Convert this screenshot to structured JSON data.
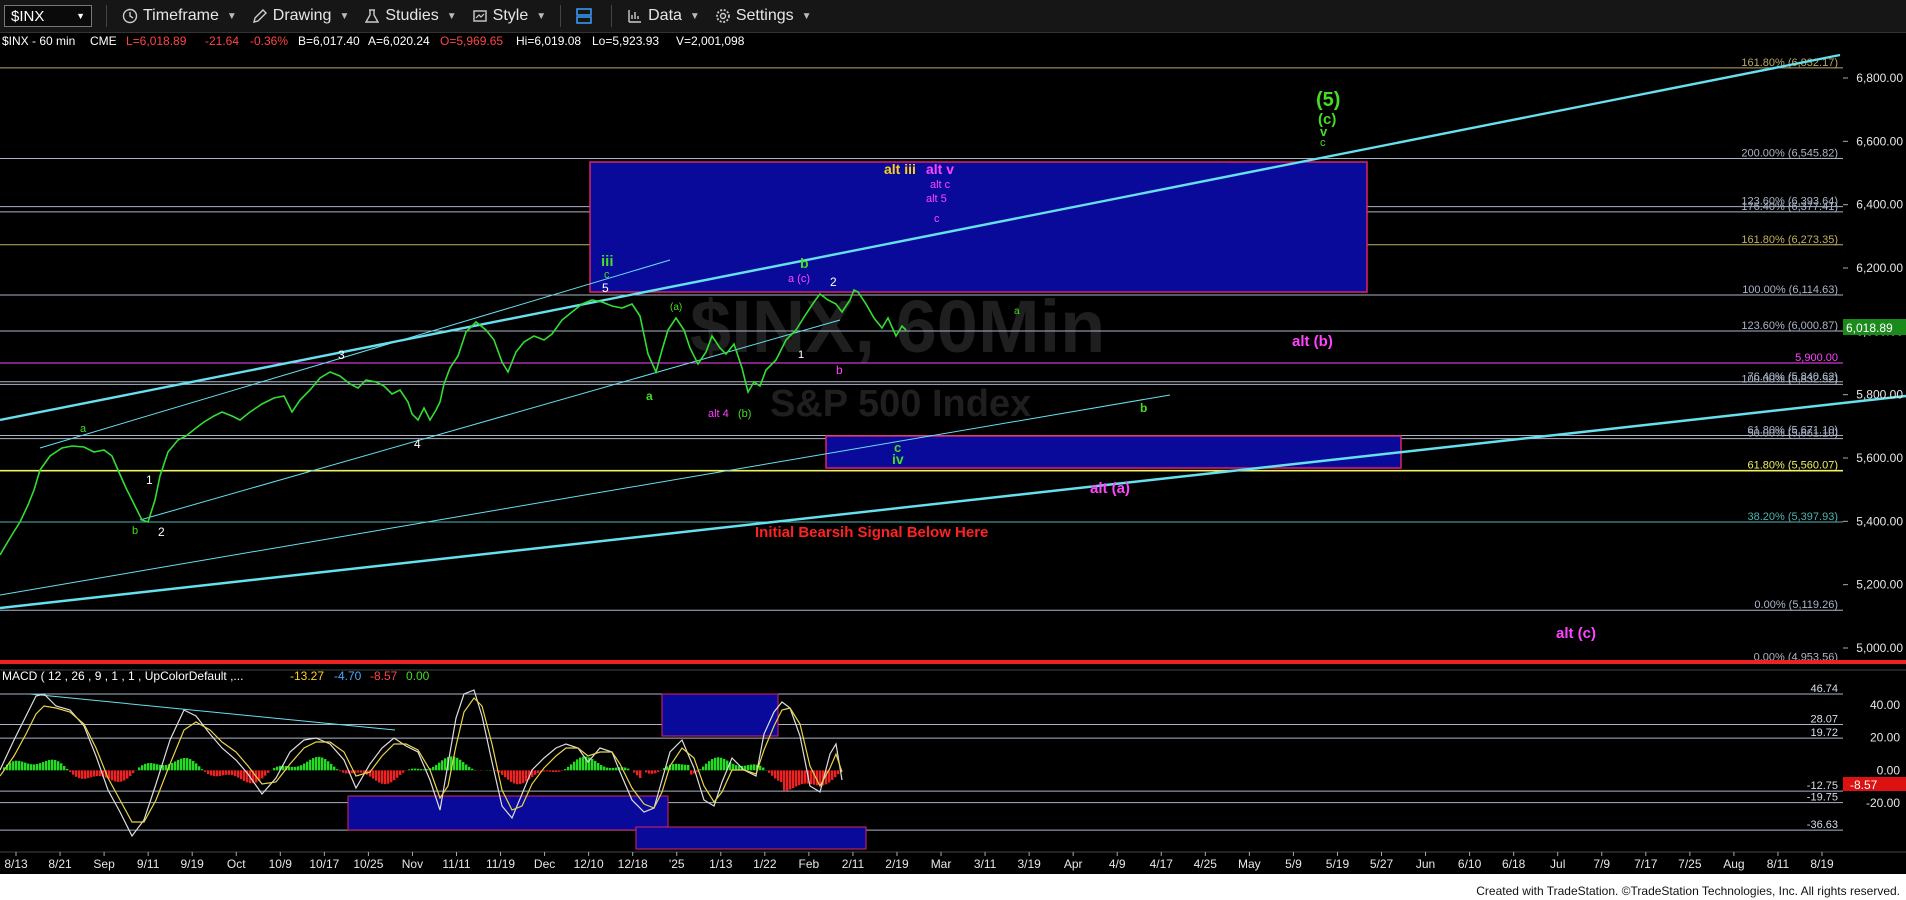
{
  "toolbar": {
    "symbol": "$INX",
    "timeframe": "Timeframe",
    "drawing": "Drawing",
    "studies": "Studies",
    "style": "Style",
    "data": "Data",
    "settings": "Settings"
  },
  "header": {
    "symbol": "$INX - 60 min",
    "exchange": "CME",
    "last": "L=6,018.89",
    "change": "-21.64",
    "change_pct": "-0.36%",
    "bid": "B=6,017.40",
    "ask": "A=6,020.24",
    "open": "O=5,969.65",
    "high": "Hi=6,019.08",
    "low": "Lo=5,923.93",
    "volume": "V=2,001,098"
  },
  "watermark": {
    "line1": "$INX, 60Min",
    "line2": "S&P 500 Index"
  },
  "price_axis": {
    "ticks": [
      "6,800.00",
      "6,600.00",
      "6,400.00",
      "6,200.00",
      "6,000.00",
      "5,800.00",
      "5,600.00",
      "5,400.00",
      "5,200.00",
      "5,000.00"
    ],
    "last_price": "6,018.89"
  },
  "fib_levels": [
    {
      "label": "161.80% (6,832.17)",
      "value": 6832.17,
      "color": "#b8a868"
    },
    {
      "label": "200.00% (6,545.82)",
      "value": 6545.82,
      "color": "#aab4c8"
    },
    {
      "label": "123.60% (6,393.64)",
      "value": 6393.64,
      "color": "#aab4c8"
    },
    {
      "label": "176.40% (6,377.41)",
      "value": 6377.41,
      "color": "#aab4c8"
    },
    {
      "label": "161.80% (6,273.35)",
      "value": 6273.35,
      "color": "#c0b060"
    },
    {
      "label": "100.00% (6,114.63)",
      "value": 6114.63,
      "color": "#aab4c8"
    },
    {
      "label": "123.60% (6,000.87)",
      "value": 6000.87,
      "color": "#aab4c8"
    },
    {
      "label": "5,900.00",
      "value": 5900,
      "color": "#ff44ff"
    },
    {
      "label": "76.40% (5,840.62)",
      "value": 5840.62,
      "color": "#aab4c8"
    },
    {
      "label": "100.00% (5,832.52)",
      "value": 5832.52,
      "color": "#aab4c8"
    },
    {
      "label": "61.80% (5,671.10)",
      "value": 5671.1,
      "color": "#aab4c8"
    },
    {
      "label": "50.00% (5,661.10)",
      "value": 5661.1,
      "color": "#aab4c8"
    },
    {
      "label": "61.80% (5,560.07)",
      "value": 5560.07,
      "color": "#f0f060"
    },
    {
      "label": "38.20% (5,397.93)",
      "value": 5397.93,
      "color": "#4fb3b0"
    },
    {
      "label": "0.00% (5,119.26)",
      "value": 5119.26,
      "color": "#aab4c8"
    },
    {
      "label": "0.00% (4,953.56)",
      "value": 4953.56,
      "color": "#aab4c8"
    }
  ],
  "date_axis": [
    "8/13",
    "8/21",
    "Sep",
    "9/11",
    "9/19",
    "Oct",
    "10/9",
    "10/17",
    "10/25",
    "Nov",
    "11/11",
    "11/19",
    "Dec",
    "12/10",
    "12/18",
    "'25",
    "1/13",
    "1/22",
    "Feb",
    "2/11",
    "2/19",
    "Mar",
    "3/11",
    "3/19",
    "Apr",
    "4/9",
    "4/17",
    "4/25",
    "May",
    "5/9",
    "5/19",
    "5/27",
    "Jun",
    "6/10",
    "6/18",
    "Jul",
    "7/9",
    "7/17",
    "7/25",
    "Aug",
    "8/11",
    "8/19"
  ],
  "annotations": {
    "wave5": "(5)",
    "wave_c_big": "(c)",
    "wave_v": "v",
    "wave_c_small": "c",
    "alt_iii": "alt iii",
    "alt_v": "alt v",
    "alt_c": "alt c",
    "alt_5": "alt 5",
    "c_mag": "c",
    "iii": "iii",
    "c_iii": "c",
    "five": "5",
    "b_green": "b",
    "a_c": "a (c)",
    "two": "2",
    "a_green": "a",
    "alt_b": "alt (b)",
    "b_mag": "b",
    "one": "1",
    "a_paren": "(a)",
    "three": "3",
    "four": "4",
    "a_low": "a",
    "alt4": "alt 4",
    "b_paren": "(b)",
    "b_right": "b",
    "c_iv": "c",
    "iv": "iv",
    "alt_a": "alt (a)",
    "alt_c_big": "alt (c)",
    "a_left": "a",
    "b_left": "b",
    "one_left": "1",
    "two_left": "2",
    "bearish": "Initial Bearsih Signal Below Here"
  },
  "macd": {
    "title": "MACD ( 12 , 26 , 9 , 1 , 1 , UpColorDefault ,...",
    "v1": "-13.27",
    "v2": "-4.70",
    "v3": "-8.57",
    "v4": "0.00",
    "levels": [
      {
        "label": "46.74",
        "value": 46.74
      },
      {
        "label": "28.07",
        "value": 28.07
      },
      {
        "label": "19.72",
        "value": 19.72
      },
      {
        "label": "-12.75",
        "value": -12.75
      },
      {
        "label": "-19.75",
        "value": -19.75
      },
      {
        "label": "-36.63",
        "value": -36.63
      }
    ],
    "axis_ticks": [
      "40.00",
      "20.00",
      "0.00",
      "-20.00"
    ],
    "last": "-8.57"
  },
  "colors": {
    "bg": "#000000",
    "price": "#33dd33",
    "trend": "#66e0ee",
    "box": "#0a0a9a",
    "green": "#44dd22",
    "magenta": "#ff44ff",
    "yellow": "#ffd21a",
    "red": "#ff2222"
  },
  "footer": "Created with TradeStation. ©TradeStation Technologies, Inc. All rights reserved."
}
